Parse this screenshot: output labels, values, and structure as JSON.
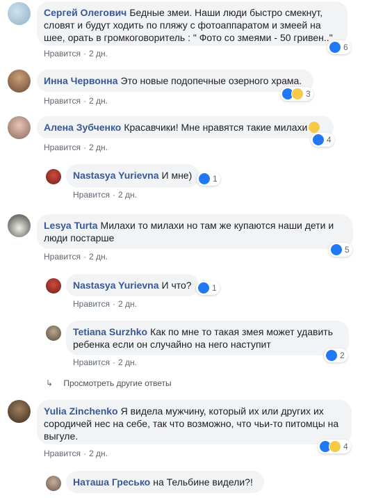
{
  "actions": {
    "like": "Нравится",
    "time": "2 дн."
  },
  "comments": [
    {
      "author": "Сергей Олегович",
      "text": "Бедные змеи. Наши люди быстро смекнут, словят и будут ходить по пляжу с фотоаппаратом и змеей на шее, орать в громкоговоритель : \" Фото со змеями - 50 гривен..\"",
      "reactions": "6"
    },
    {
      "author": "Инна Червонна",
      "text": "Это новые подопечные озерного храма.",
      "reactions": "3"
    },
    {
      "author": "Алена Зубченко",
      "text": "Красавчики! Мне нравятся такие милахи",
      "reactions": "4"
    },
    {
      "author": "Nastasya Yurievna",
      "text": "И мне)",
      "reactions": "1"
    },
    {
      "author": "Lesya Turta",
      "text": "Милахи то милахи но там же купаются наши дети и люди постарше",
      "reactions": "5"
    },
    {
      "author": "Nastasya Yurievna",
      "text": "И что?",
      "reactions": "1"
    },
    {
      "author": "Tetiana Surzhko",
      "text": "Как по мне то такая змея может удавить ребенка если он случайно на него наступит",
      "reactions": "2"
    },
    {
      "author": "Yulia Zinchenko",
      "text": "Я видела мужчину, который их или других их сородичей нес на себе, так что возможно, что чьи-то питомцы на выгуле.",
      "reactions": "4"
    },
    {
      "author": "Наташа Гресько",
      "text": "на Тельбине видели?!"
    }
  ],
  "more_replies": "Просмотреть другие ответы"
}
